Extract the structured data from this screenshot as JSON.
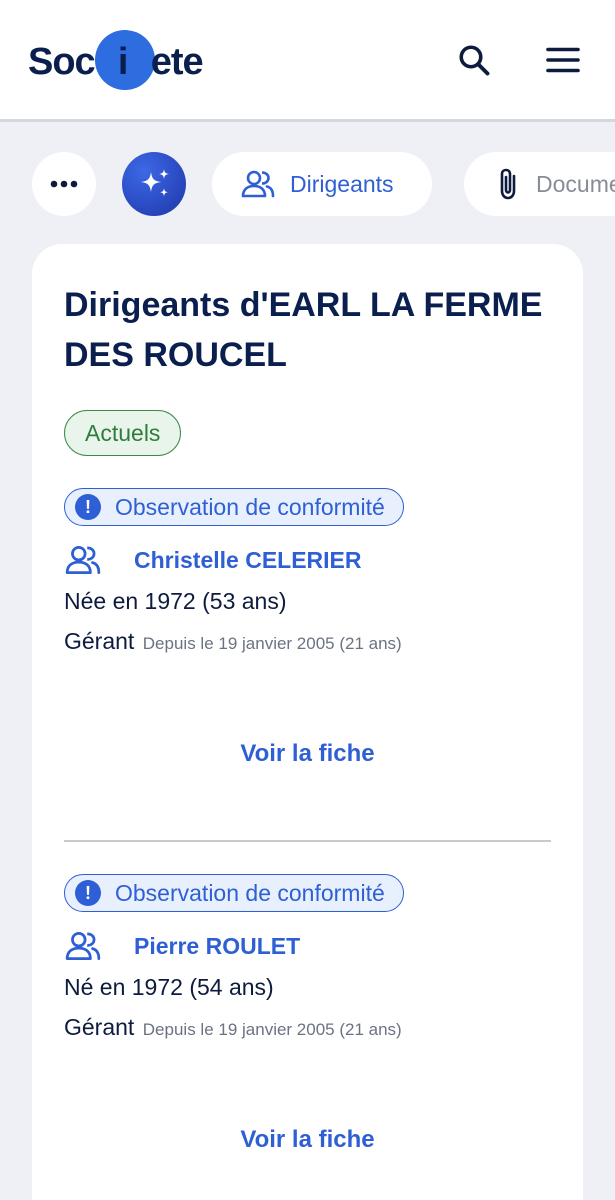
{
  "header": {
    "logo": {
      "pre": "Soc",
      "i": "i",
      "post": "ete"
    },
    "search_icon": "search-icon",
    "menu_icon": "hamburger-menu-icon"
  },
  "chips": {
    "more_icon": "more-dots-icon",
    "ai_icon": "sparkles-icon",
    "dirigeants_label": "Dirigeants",
    "documents_label": "Documents"
  },
  "card": {
    "title": "Dirigeants d'EARL LA FERME DES ROUCEL",
    "badge": "Actuels",
    "entries": [
      {
        "observation": "Observation de conformité",
        "name": "Christelle CELERIER",
        "birth": "Née en 1972 (53 ans)",
        "role": "Gérant",
        "since": "Depuis le 19 janvier 2005 (21 ans)",
        "link": "Voir la fiche"
      },
      {
        "observation": "Observation de conformité",
        "name": "Pierre ROULET",
        "birth": "Né en 1972 (54 ans)",
        "role": "Gérant",
        "since": "Depuis le 19 janvier 2005 (21 ans)",
        "link": "Voir la fiche"
      }
    ]
  },
  "colors": {
    "accent": "#2e5fd4",
    "navy": "#0b1f4f",
    "success": "#2e7d3e",
    "background": "#eef0f5"
  }
}
